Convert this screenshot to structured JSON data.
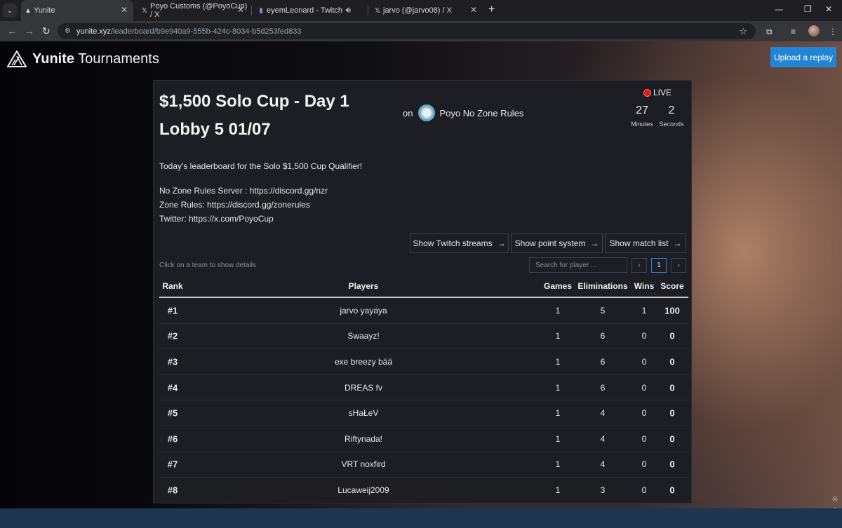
{
  "browser": {
    "tabs": [
      {
        "title": "Yunite",
        "icon": "yunite-icon",
        "active": true
      },
      {
        "title": "Poyo Customs (@PoyoCup) / X",
        "icon": "x-icon"
      },
      {
        "title": "eyemLeonard - Twitch",
        "icon": "twitch-icon",
        "audio": true
      },
      {
        "title": "jarvo (@jarvo08) / X",
        "icon": "x-icon"
      }
    ],
    "url_host": "yunite.xyz",
    "url_path": "/leaderboard/b9e940a9-555b-424c-8034-b5d253fed833"
  },
  "header": {
    "brand_bold": "Yunite",
    "brand_rest": " Tournaments",
    "upload_label": "Upload a replay"
  },
  "tournament": {
    "title": "$1,500 Solo Cup - Day 1 Lobby 5 01/07",
    "on_label": "on",
    "organizer": "Poyo No Zone Rules",
    "live_label": "LIVE",
    "countdown": {
      "minutes_value": "27",
      "minutes_label": "Minutes",
      "seconds_value": "2",
      "seconds_label": "Seconds"
    },
    "description": [
      "Today's leaderboard for the Solo $1,500 Cup Qualifier!",
      "No Zone Rules Server : https://discord.gg/nzr",
      "Zone Rules: https://discord.gg/zonerules",
      "Twitter: https://x.com/PoyoCup"
    ]
  },
  "actions": {
    "twitch": "Show Twitch streams",
    "points": "Show point system",
    "matches": "Show match list"
  },
  "controls": {
    "hint": "Click on a team to show details",
    "search_placeholder": "Search for player ...",
    "prev": "‹",
    "page": "1",
    "next": "›"
  },
  "leaderboard": {
    "headers": {
      "rank": "Rank",
      "players": "Players",
      "games": "Games",
      "eliminations": "Eliminations",
      "wins": "Wins",
      "score": "Score"
    },
    "rows": [
      {
        "rank": "#1",
        "player": "jarvo yayaya",
        "games": "1",
        "eliminations": "5",
        "wins": "1",
        "score": "100"
      },
      {
        "rank": "#2",
        "player": "Swaayz!",
        "games": "1",
        "eliminations": "6",
        "wins": "0",
        "score": "0"
      },
      {
        "rank": "#3",
        "player": "exe breezy bää",
        "games": "1",
        "eliminations": "6",
        "wins": "0",
        "score": "0"
      },
      {
        "rank": "#4",
        "player": "DREAS fv",
        "games": "1",
        "eliminations": "6",
        "wins": "0",
        "score": "0"
      },
      {
        "rank": "#5",
        "player": "sHaŁeV",
        "games": "1",
        "eliminations": "4",
        "wins": "0",
        "score": "0"
      },
      {
        "rank": "#6",
        "player": "Riftynada!",
        "games": "1",
        "eliminations": "4",
        "wins": "0",
        "score": "0"
      },
      {
        "rank": "#7",
        "player": "VRT noxfird",
        "games": "1",
        "eliminations": "4",
        "wins": "0",
        "score": "0"
      },
      {
        "rank": "#8",
        "player": "Lucaweij2009",
        "games": "1",
        "eliminations": "3",
        "wins": "0",
        "score": "0"
      }
    ]
  },
  "colors": {
    "accent": "#2284d4",
    "live": "#e01919",
    "card": "#1c1e23"
  }
}
